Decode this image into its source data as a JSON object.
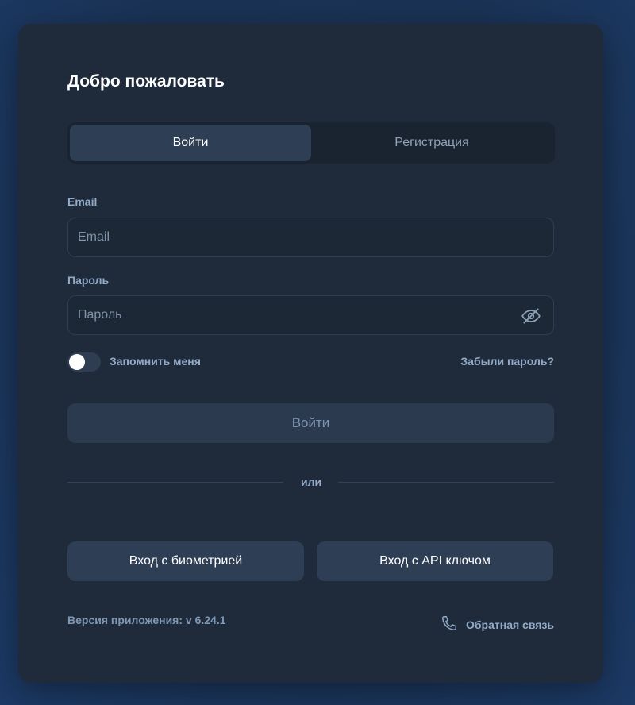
{
  "title": "Добро пожаловать",
  "tabs": [
    {
      "label": "Войти",
      "active": true
    },
    {
      "label": "Регистрация",
      "active": false
    }
  ],
  "email": {
    "label": "Email",
    "placeholder": "Email",
    "value": ""
  },
  "password": {
    "label": "Пароль",
    "placeholder": "Пароль",
    "value": "",
    "toggle_icon": "eye-off-icon"
  },
  "remember": {
    "label": "Запомнить меня",
    "checked": false
  },
  "forgot_link": "Забыли пароль?",
  "submit_label": "Войти",
  "divider_text": "или",
  "alt_buttons": {
    "biometric": "Вход с биометрией",
    "api_key": "Вход с API ключом"
  },
  "footer": {
    "version": "Версия приложения: v 6.24.1",
    "feedback": "Обратная связь",
    "feedback_icon": "phone-icon"
  },
  "colors": {
    "card": "#1f2b3a",
    "active_tab": "#2e3f55",
    "accent_text": "#93abc8"
  }
}
